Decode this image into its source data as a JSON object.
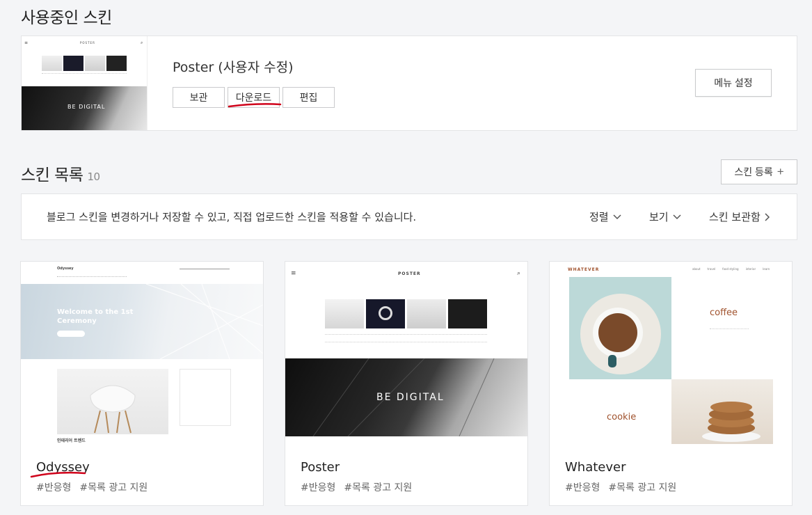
{
  "current_section": {
    "title": "사용중인 스킨",
    "skin_name": "Poster (사용자 수정)",
    "actions": [
      "보관",
      "다운로드",
      "편집"
    ],
    "menu_button": "메뉴 설정",
    "thumb_logo": "POSTER",
    "thumb_banner": "BE DIGITAL"
  },
  "list_section": {
    "title": "스킨 목록",
    "count": "10",
    "register_button": "스킨 등록",
    "info_text": "블로그 스킨을 변경하거나 저장할 수 있고, 직접 업로드한 스킨을 적용할 수 있습니다.",
    "sort_label": "정렬",
    "view_label": "보기",
    "archive_label": "스킨 보관함"
  },
  "skins": [
    {
      "name": "Odyssey",
      "tags": [
        "#반응형",
        "#목록 광고 지원"
      ],
      "thumb": {
        "logo": "Odyssey",
        "banner": "Welcome to the 1st Ceremony",
        "section": "인테리어 트렌드"
      }
    },
    {
      "name": "Poster",
      "tags": [
        "#반응형",
        "#목록 광고 지원"
      ],
      "thumb": {
        "logo": "POSTER",
        "banner": "BE DIGITAL"
      }
    },
    {
      "name": "Whatever",
      "tags": [
        "#반응형",
        "#목록 광고 지원"
      ],
      "thumb": {
        "logo": "WHATEVER",
        "nav": [
          "about",
          "travel",
          "food styling",
          "interior",
          "learn"
        ],
        "item1": "coffee",
        "item2": "cookie"
      }
    }
  ],
  "colors": {
    "accent_underline": "#d0021b",
    "page_bg": "#f4f5f7"
  }
}
